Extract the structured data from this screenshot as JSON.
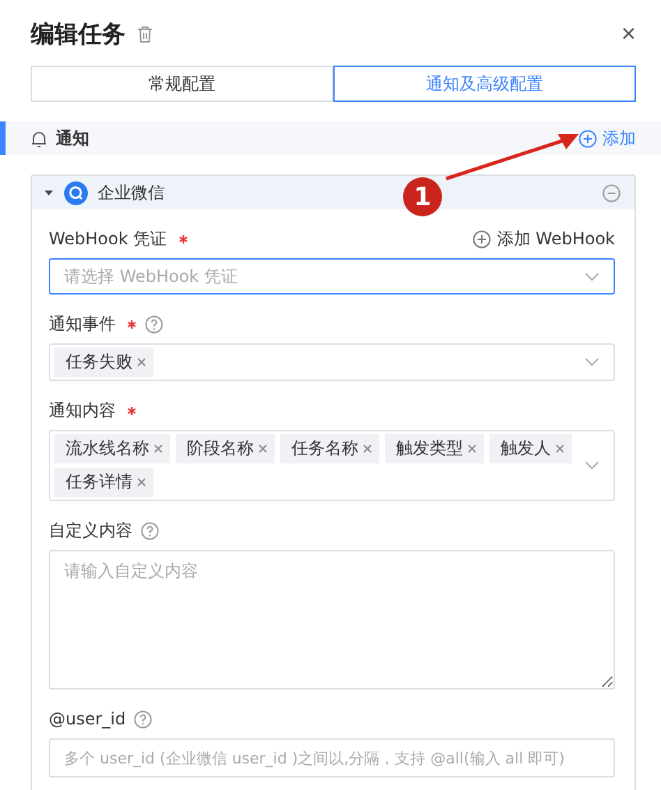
{
  "dialog": {
    "title": "编辑任务",
    "close": "×"
  },
  "tabs": [
    {
      "label": "常规配置",
      "selected": false
    },
    {
      "label": "通知及高级配置",
      "selected": true
    }
  ],
  "section": {
    "title": "通知",
    "add": "添加"
  },
  "card": {
    "title": "企业微信",
    "expanded": true,
    "fields": [
      {
        "kind": "select",
        "label": "WebHook 凭证",
        "required": true,
        "help": false,
        "action": "添加 WebHook",
        "placeholder": "请选择 WebHook 凭证",
        "focused": true
      },
      {
        "kind": "tags",
        "label": "通知事件",
        "required": true,
        "help": true,
        "tags": [
          "任务失败"
        ]
      },
      {
        "kind": "tags",
        "label": "通知内容",
        "required": true,
        "help": false,
        "tags": [
          "流水线名称",
          "阶段名称",
          "任务名称",
          "触发类型",
          "触发人",
          "任务详情"
        ]
      },
      {
        "kind": "textarea",
        "label": "自定义内容",
        "required": false,
        "help": true,
        "placeholder": "请输入自定义内容"
      },
      {
        "kind": "input",
        "label": "@user_id",
        "required": false,
        "help": true,
        "placeholder": "多个 user_id (企业微信 user_id )之间以,分隔，支持 @all(输入 all 即可)"
      }
    ]
  },
  "annotation": {
    "number": "1"
  }
}
